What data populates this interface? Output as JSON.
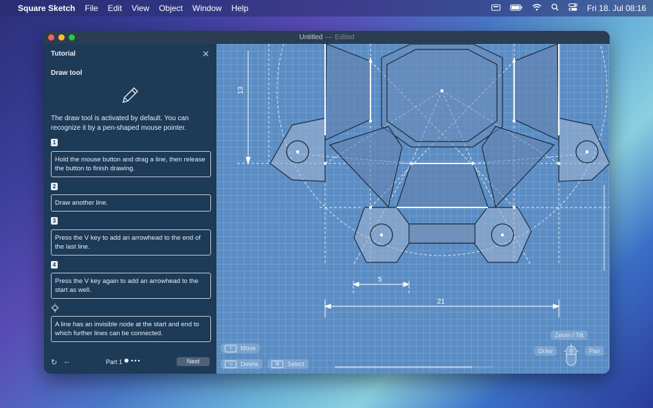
{
  "menubar": {
    "app_name": "Square Sketch",
    "items": [
      "File",
      "Edit",
      "View",
      "Object",
      "Window",
      "Help"
    ],
    "datetime": "Fri 18. Jul  08:16"
  },
  "window": {
    "title": "Untitled",
    "separator": "—",
    "status": "Edited"
  },
  "tutorial": {
    "title": "Tutorial",
    "section": "Draw tool",
    "intro": "The draw tool is activated by default. You can recognize it by a pen-shaped mouse pointer.",
    "steps": [
      {
        "num": "1",
        "text": "Hold the mouse button and drag a line, then release the button to finish drawing."
      },
      {
        "num": "2",
        "text": "Draw another line."
      },
      {
        "num": "3",
        "text": "Press the V key to add an arrowhead to the end of the last line."
      },
      {
        "num": "4",
        "text": "Press the V key again to add an arrowhead to the start as well."
      }
    ],
    "tip": "A line has an invisible node at the start and end to which further lines can be connected.",
    "part_label": "Part 1",
    "next_label": "Next"
  },
  "canvas": {
    "dimensions": [
      "13",
      "5",
      "21"
    ],
    "hints": {
      "move": "Move",
      "delete": "Delete",
      "select": "Select",
      "zoom_tilt": "Zoom / Tilt",
      "draw": "Draw",
      "pan": "Pan"
    }
  },
  "colors": {
    "canvas_bg": "#5b8dc4",
    "panel_bg": "#1d3a57",
    "close_button": "#ff5f57",
    "minimize_button": "#febc2e",
    "zoom_button": "#28c840"
  }
}
